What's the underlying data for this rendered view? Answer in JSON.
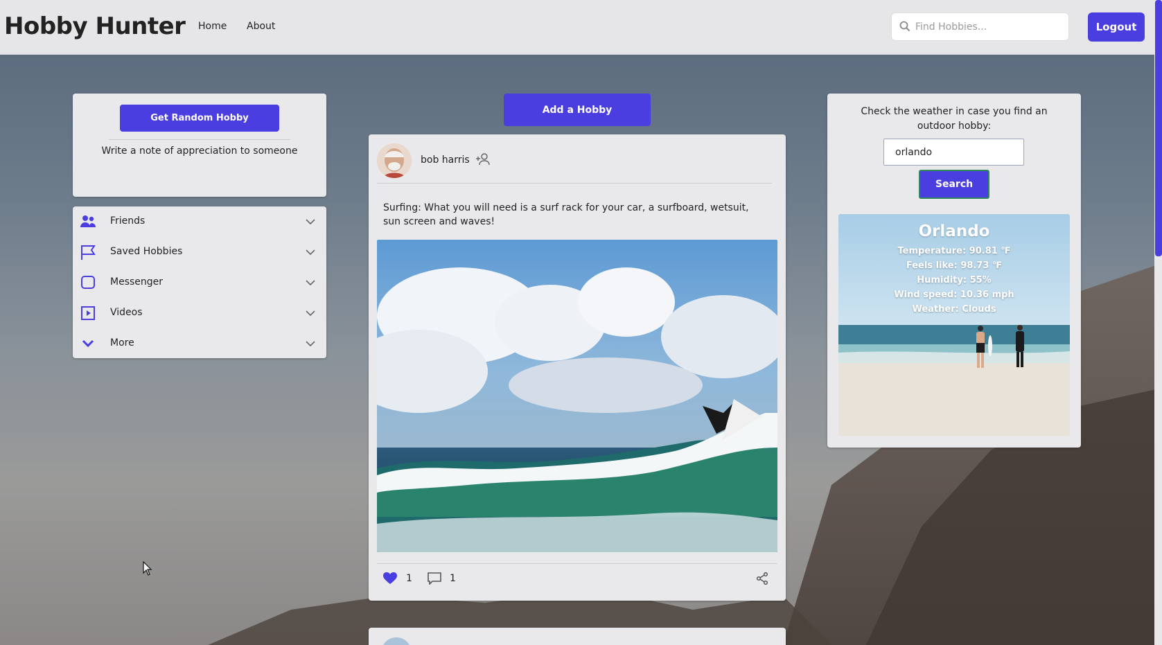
{
  "header": {
    "brand": "Hobby Hunter",
    "nav": [
      "Home",
      "About"
    ],
    "search_placeholder": "Find Hobbies...",
    "logout_label": "Logout"
  },
  "left": {
    "random_button": "Get Random Hobby",
    "random_note": "Write a note of appreciation to someone",
    "menu": [
      {
        "label": "Friends",
        "icon": "friends-icon"
      },
      {
        "label": "Saved Hobbies",
        "icon": "flag-icon"
      },
      {
        "label": "Messenger",
        "icon": "messenger-icon"
      },
      {
        "label": "Videos",
        "icon": "video-icon"
      },
      {
        "label": "More",
        "icon": "chevron-down-icon"
      }
    ]
  },
  "center": {
    "add_button": "Add a Hobby",
    "post": {
      "user": "bob harris",
      "text": "Surfing: What you will need is a surf rack for your car, a surfboard, wetsuit, sun screen and waves!",
      "likes": "1",
      "comments": "1"
    }
  },
  "right": {
    "prompt": "Check the weather in case you find an outdoor hobby:",
    "city_value": "orlando",
    "search_button": "Search",
    "weather": {
      "city": "Orlando",
      "temperature": "Temperature: 90.81 ℉",
      "feels_like": "Feels like: 98.73 ℉",
      "humidity": "Humidity: 55%",
      "wind": "Wind speed: 10.36 mph",
      "condition": "Weather: Clouds"
    }
  },
  "colors": {
    "accent": "#4b3ee0",
    "header_bg": "#e6e6e9",
    "card_bg": "#e9e9ec"
  }
}
